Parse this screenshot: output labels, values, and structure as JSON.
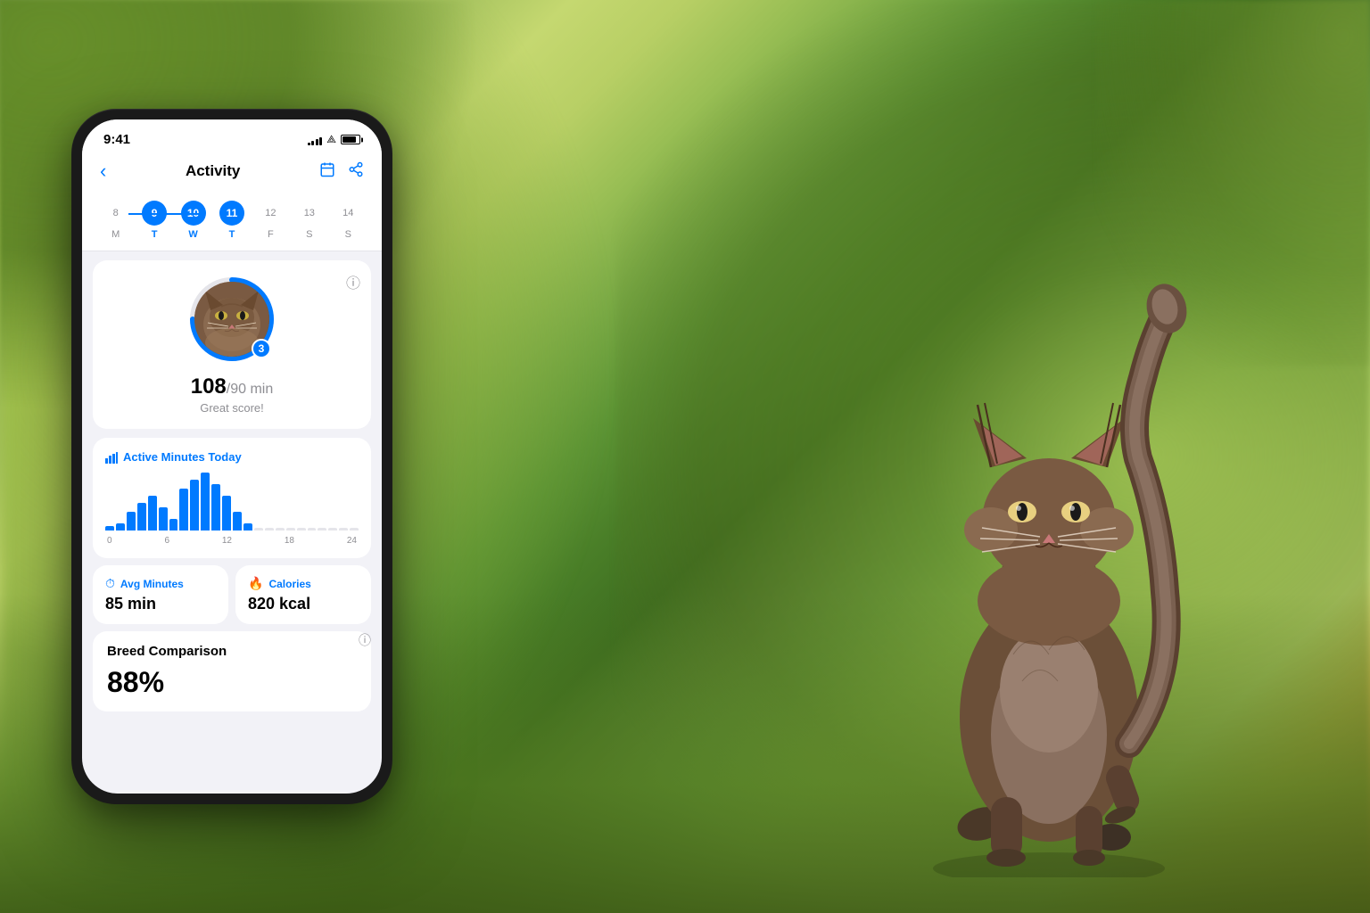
{
  "app": {
    "title": "Activity",
    "back_label": "‹"
  },
  "status_bar": {
    "time": "9:41",
    "signal_bars": [
      3,
      5,
      7,
      9,
      11
    ],
    "wifi": "WiFi",
    "battery_pct": 85
  },
  "calendar": {
    "days": [
      {
        "number": "8",
        "label": "M",
        "active": false
      },
      {
        "number": "9",
        "label": "T",
        "active": true
      },
      {
        "number": "10",
        "label": "W",
        "active": true
      },
      {
        "number": "11",
        "label": "T",
        "active": true
      },
      {
        "number": "12",
        "label": "F",
        "active": false
      },
      {
        "number": "13",
        "label": "S",
        "active": false
      },
      {
        "number": "14",
        "label": "S",
        "active": false
      }
    ]
  },
  "score": {
    "current": "108",
    "target": "90",
    "unit": "min",
    "label": "Great score!",
    "badge": "3"
  },
  "chart": {
    "title": "Active Minutes Today",
    "bars": [
      2,
      3,
      8,
      12,
      15,
      10,
      5,
      18,
      22,
      25,
      20,
      15,
      8,
      3,
      0,
      0,
      0,
      0,
      0,
      0,
      0,
      0,
      0,
      0
    ],
    "x_labels": [
      "0",
      "6",
      "12",
      "18",
      "24"
    ]
  },
  "stats": {
    "avg_minutes": {
      "label": "Avg Minutes",
      "value": "85 min",
      "icon": "clock"
    },
    "calories": {
      "label": "Calories",
      "value": "820 kcal",
      "icon": "flame"
    }
  },
  "breed_comparison": {
    "title": "Breed Comparison",
    "percent": "88%"
  },
  "colors": {
    "blue": "#007AFF",
    "gray_light": "#f2f2f7",
    "gray_text": "#8e8e93",
    "black": "#000000",
    "white": "#ffffff",
    "card_bg": "#ffffff"
  }
}
